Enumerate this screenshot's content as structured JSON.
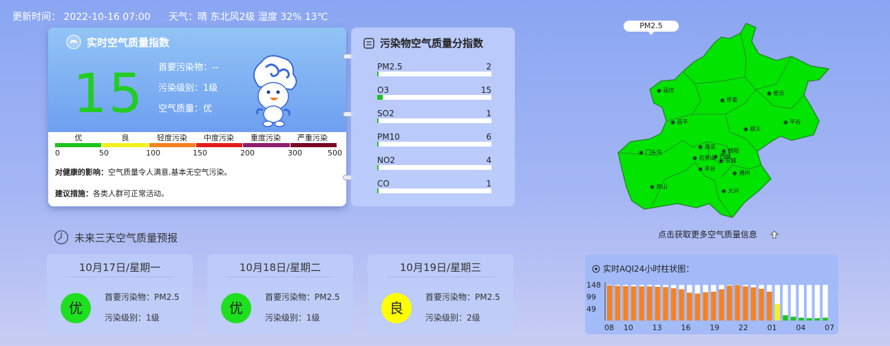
{
  "topbar": {
    "updated": "更新时间： 2022-10-16 07:00",
    "weather": "天气：晴 东北风2级 湿度 32% 13℃"
  },
  "realtime": {
    "title": "实时空气质量指数",
    "aqi": "15",
    "primary": "首要污染物：--",
    "level": "污染级别：1级",
    "quality": "空气质量：优",
    "scale_labels": [
      "优",
      "良",
      "轻度污染",
      "中度污染",
      "重度污染",
      "严重污染"
    ],
    "scale_colors": [
      "#1ec31e",
      "#f5f020",
      "#f58220",
      "#e61a1a",
      "#8e1e6e",
      "#7a0026"
    ],
    "scale_nums": [
      "0",
      "50",
      "100",
      "150",
      "200",
      "300",
      "500"
    ],
    "health_label": "对健康的影响：",
    "health_text": "空气质量令人满意,基本无空气污染。",
    "advice_label": "建议措施：",
    "advice_text": "各类人群可正常活动。"
  },
  "pollutants": {
    "title": "污染物空气质量分指数",
    "items": [
      {
        "name": "PM2.5",
        "value": "2",
        "fraction": 0.01
      },
      {
        "name": "O3",
        "value": "15",
        "fraction": 0.05
      },
      {
        "name": "SO2",
        "value": "1",
        "fraction": 0.005
      },
      {
        "name": "PM10",
        "value": "6",
        "fraction": 0.015
      },
      {
        "name": "NO2",
        "value": "4",
        "fraction": 0.01
      },
      {
        "name": "CO",
        "value": "1",
        "fraction": 0.005
      }
    ]
  },
  "map": {
    "tag": "PM2.5",
    "districts": [
      "延庆",
      "怀柔",
      "密云",
      "昌平",
      "顺义",
      "平谷",
      "门头沟",
      "海淀",
      "朝阳",
      "石景山",
      "西城",
      "东城",
      "丰台",
      "通州",
      "房山",
      "大兴"
    ],
    "fill_color": "#00e400",
    "caption": "点击获取更多空气质量信息"
  },
  "forecast": {
    "title": "未来三天空气质量预报",
    "days": [
      {
        "date": "10月17日/星期一",
        "grade": "优",
        "color": "#1ee01e",
        "primary": "首要污染物：PM2.5",
        "level": "污染级别：1级"
      },
      {
        "date": "10月18日/星期二",
        "grade": "优",
        "color": "#1ee01e",
        "primary": "首要污染物：PM2.5",
        "level": "污染级别：1级"
      },
      {
        "date": "10月19日/星期三",
        "grade": "良",
        "color": "#ffff00",
        "primary": "首要污染物：PM2.5",
        "level": "污染级别：2级"
      }
    ]
  },
  "chart_data": {
    "type": "bar",
    "title": "实时AQI24小时柱状图：",
    "y_ticks": [
      "148",
      "99",
      "49"
    ],
    "ylim": [
      0,
      160
    ],
    "x_ticks": [
      "08",
      "10",
      "13",
      "16",
      "19",
      "22",
      "01",
      "04",
      "07"
    ],
    "x_tick_positions": [
      0,
      2,
      5,
      8,
      11,
      14,
      17,
      20,
      23
    ],
    "values": [
      146,
      144,
      143,
      142,
      142,
      142,
      140,
      139,
      134,
      130,
      116,
      112,
      118,
      120,
      130,
      145,
      147,
      142,
      138,
      132,
      120,
      68,
      22,
      16,
      12,
      10,
      10,
      12
    ],
    "colors": [
      "#f58220",
      "#f58220",
      "#f58220",
      "#f58220",
      "#f58220",
      "#f58220",
      "#f58220",
      "#f58220",
      "#f58220",
      "#f58220",
      "#f58220",
      "#f58220",
      "#f58220",
      "#f58220",
      "#f58220",
      "#f58220",
      "#f58220",
      "#f58220",
      "#f58220",
      "#f58220",
      "#f58220",
      "#f5f020",
      "#1ec31e",
      "#1ec31e",
      "#1ec31e",
      "#1ec31e",
      "#1ec31e",
      "#1ec31e"
    ]
  }
}
